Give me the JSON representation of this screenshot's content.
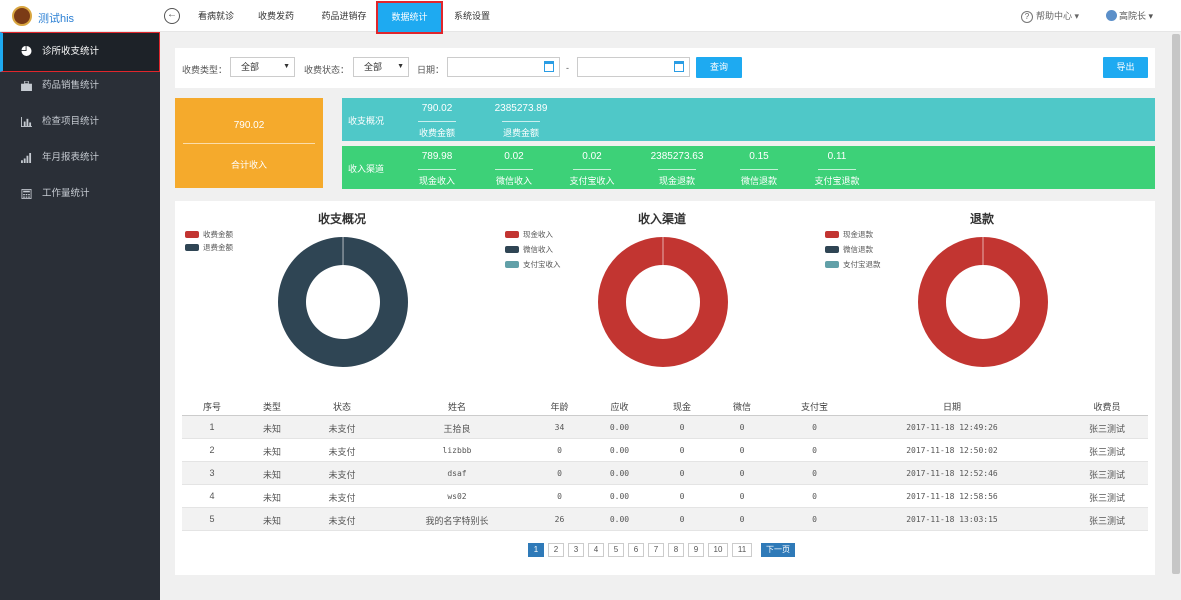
{
  "app": {
    "title": "测试his"
  },
  "topnav": {
    "items": [
      "看病就诊",
      "收费发药",
      "药品进销存",
      "数据统计",
      "系统设置"
    ],
    "help": "帮助中心",
    "user": "高院长"
  },
  "sidebar": {
    "items": [
      "诊所收支统计",
      "药品销售统计",
      "检查项目统计",
      "年月报表统计",
      "工作量统计"
    ]
  },
  "filters": {
    "fee_type_label": "收费类型：",
    "fee_type_value": "全部",
    "fee_status_label": "收费状态：",
    "fee_status_value": "全部",
    "date_label": "日期：",
    "date_sep": "-",
    "query": "查询",
    "export": "导出"
  },
  "summary": {
    "total": {
      "value": "790.02",
      "label": "合计收入"
    },
    "overview": {
      "label": "收支概况",
      "items": [
        {
          "value": "790.02",
          "label": "收费金额"
        },
        {
          "value": "2385273.89",
          "label": "退费金额"
        }
      ]
    },
    "channels": {
      "label": "收入渠道",
      "items": [
        {
          "value": "789.98",
          "label": "现金收入"
        },
        {
          "value": "0.02",
          "label": "微信收入"
        },
        {
          "value": "0.02",
          "label": "支付宝收入"
        },
        {
          "value": "2385273.63",
          "label": "现金退款"
        },
        {
          "value": "0.15",
          "label": "微信退款"
        },
        {
          "value": "0.11",
          "label": "支付宝退款"
        }
      ]
    }
  },
  "charts": [
    {
      "title": "收支概况",
      "legend": [
        "收费金额",
        "退费金额"
      ],
      "colors": [
        "#c23531",
        "#2f4554"
      ],
      "values": [
        790.02,
        2385273.89
      ]
    },
    {
      "title": "收入渠道",
      "legend": [
        "现金收入",
        "微信收入",
        "支付宝收入"
      ],
      "colors": [
        "#c23531",
        "#2f4554",
        "#61a0a8"
      ],
      "values": [
        789.98,
        0.02,
        0.02
      ]
    },
    {
      "title": "退款",
      "legend": [
        "现金退款",
        "微信退款",
        "支付宝退款"
      ],
      "colors": [
        "#c23531",
        "#2f4554",
        "#61a0a8"
      ],
      "values": [
        2385273.63,
        0.15,
        0.11
      ]
    }
  ],
  "table": {
    "headers": [
      "序号",
      "类型",
      "状态",
      "姓名",
      "年龄",
      "应收",
      "现金",
      "微信",
      "支付宝",
      "日期",
      "收费员"
    ],
    "rows": [
      [
        "1",
        "未知",
        "未支付",
        "王拾良",
        "34",
        "0.00",
        "0",
        "0",
        "0",
        "2017-11-18 12:49:26",
        "张三测试"
      ],
      [
        "2",
        "未知",
        "未支付",
        "lizbbb",
        "0",
        "0.00",
        "0",
        "0",
        "0",
        "2017-11-18 12:50:02",
        "张三测试"
      ],
      [
        "3",
        "未知",
        "未支付",
        "dsaf",
        "0",
        "0.00",
        "0",
        "0",
        "0",
        "2017-11-18 12:52:46",
        "张三测试"
      ],
      [
        "4",
        "未知",
        "未支付",
        "ws02",
        "0",
        "0.00",
        "0",
        "0",
        "0",
        "2017-11-18 12:58:56",
        "张三测试"
      ],
      [
        "5",
        "未知",
        "未支付",
        "我的名字特别长",
        "26",
        "0.00",
        "0",
        "0",
        "0",
        "2017-11-18 13:03:15",
        "张三测试"
      ]
    ]
  },
  "pager": {
    "pages": [
      "1",
      "2",
      "3",
      "4",
      "5",
      "6",
      "7",
      "8",
      "9",
      "10",
      "11"
    ],
    "current": "1",
    "next": "下一页"
  }
}
